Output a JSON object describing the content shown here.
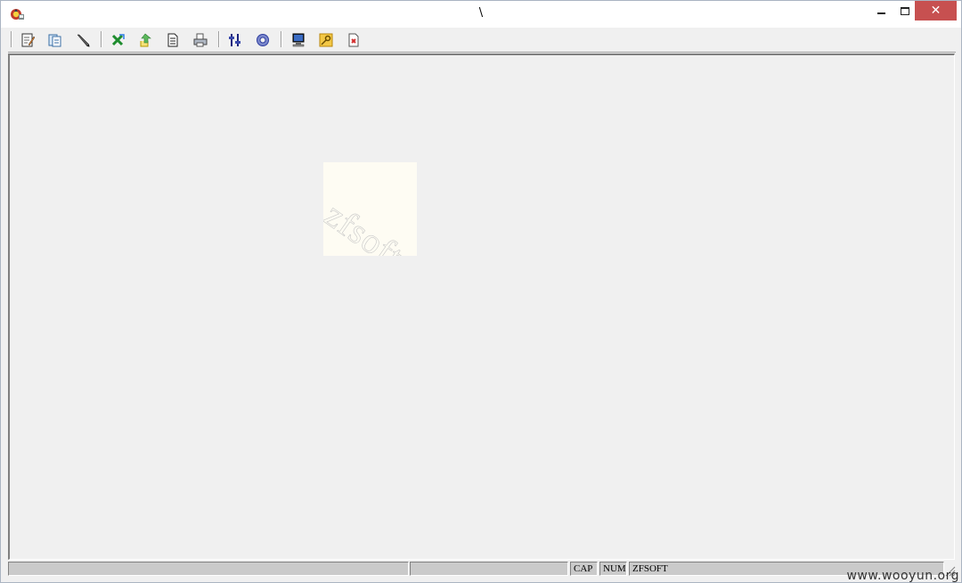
{
  "window": {
    "title": "\\",
    "controls": {
      "close_glyph": "✕"
    }
  },
  "toolbar": {
    "buttons": [
      {
        "name": "edit-document-icon",
        "group": 1
      },
      {
        "name": "copy-document-icon",
        "group": 1
      },
      {
        "name": "pen-icon",
        "group": 1
      },
      {
        "name": "excel-export-icon",
        "group": 2
      },
      {
        "name": "upload-icon",
        "group": 2
      },
      {
        "name": "page-icon",
        "group": 2
      },
      {
        "name": "print-icon",
        "group": 2
      },
      {
        "name": "filter-icon",
        "group": 3
      },
      {
        "name": "gear-icon",
        "group": 3
      },
      {
        "name": "computer-icon",
        "group": 4
      },
      {
        "name": "key-icon",
        "group": 4
      },
      {
        "name": "exit-icon",
        "group": 4
      }
    ]
  },
  "client": {
    "watermark_text": "zfsoft"
  },
  "statusbar": {
    "panes": [
      "",
      "",
      "CAP",
      "NUM",
      "ZFSOFT"
    ]
  },
  "overlay": {
    "site_watermark": "www.wooyun.org"
  }
}
